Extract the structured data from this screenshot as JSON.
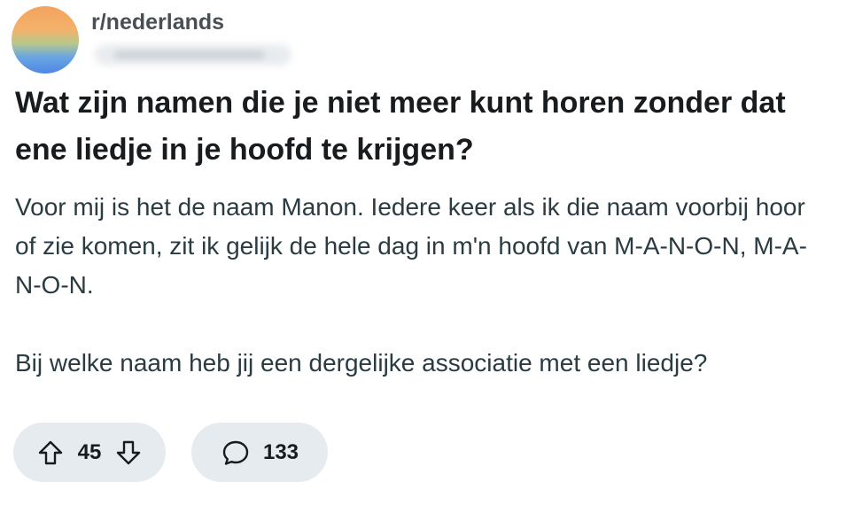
{
  "post": {
    "subreddit": "r/nederlands",
    "title": "Wat zijn namen die je niet meer kunt horen zonder dat ene liedje in je hoofd te krijgen?",
    "body": [
      "Voor mij is het de naam Manon. Iedere keer als ik die naam voorbij hoor of zie komen, zit ik gelijk de hele dag in m'n hoofd van M-A-N-O-N, M-A-N-O-N.",
      "Bij welke naam heb jij een dergelijke associatie met een liedje?"
    ]
  },
  "actions": {
    "score": "45",
    "comments_count": "133"
  },
  "icons": {
    "upvote": "arrow-up-icon",
    "downvote": "arrow-down-icon",
    "comment": "speech-bubble-icon"
  }
}
